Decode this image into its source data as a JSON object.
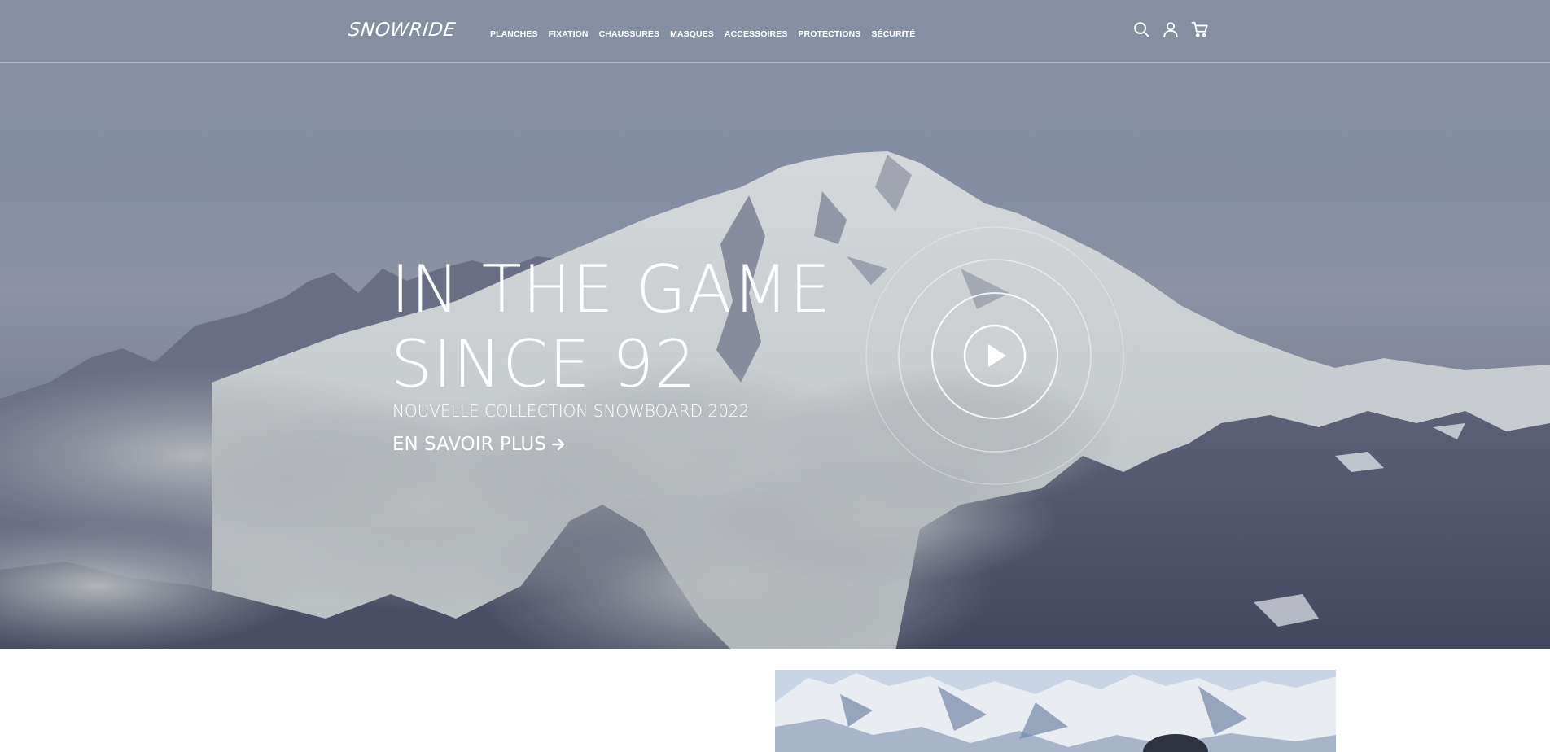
{
  "brand": {
    "logo": "SNOWRIDE"
  },
  "nav": {
    "items": [
      {
        "label": "PLANCHES"
      },
      {
        "label": "FIXATION"
      },
      {
        "label": "CHAUSSURES"
      },
      {
        "label": "MASQUES"
      },
      {
        "label": "ACCESSOIRES"
      },
      {
        "label": "PROTECTIONS"
      },
      {
        "label": "SÉCURITÉ"
      }
    ]
  },
  "header_icons": [
    "search-icon",
    "user-icon",
    "cart-icon"
  ],
  "hero": {
    "title_line1": "IN THE GAME",
    "title_line2": "SINCE 92",
    "subtitle": "NOUVELLE COLLECTION SNOWBOARD 2022",
    "cta_label": "EN SAVOIR PLUS",
    "cta_icon": "arrow-right-icon",
    "play_icon": "play-icon"
  },
  "colors": {
    "text": "#ffffff",
    "sky": "#8c94a6",
    "rock": "#4f5265"
  }
}
